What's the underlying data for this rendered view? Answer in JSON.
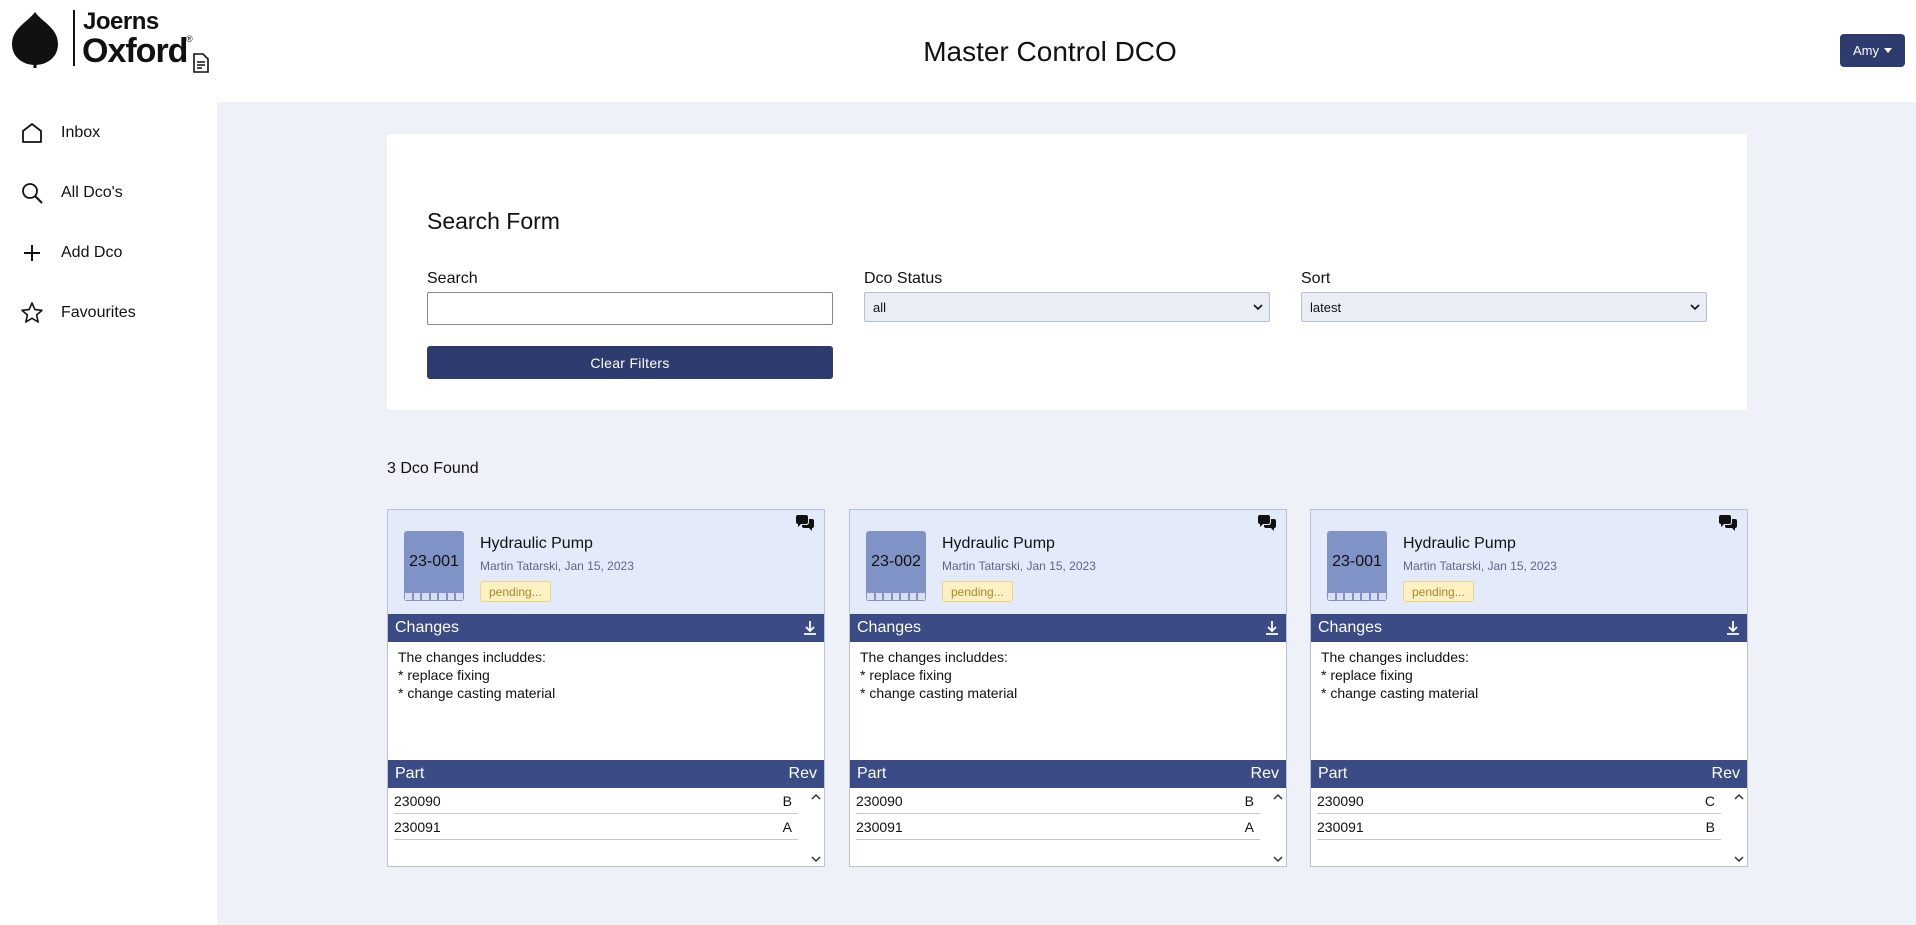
{
  "header": {
    "logo_top": "Joerns",
    "logo_bottom": "Oxford",
    "logo_reg": "®",
    "title": "Master Control DCO",
    "user_label": "Amy"
  },
  "sidebar": {
    "items": [
      {
        "label": "Inbox",
        "icon": "home-icon"
      },
      {
        "label": "All Dco's",
        "icon": "search-icon"
      },
      {
        "label": "Add Dco",
        "icon": "plus-icon"
      },
      {
        "label": "Favourites",
        "icon": "star-icon"
      }
    ]
  },
  "search_form": {
    "title": "Search Form",
    "search_label": "Search",
    "search_value": "",
    "status_label": "Dco Status",
    "status_value": "all",
    "sort_label": "Sort",
    "sort_value": "latest",
    "clear_label": "Clear Filters"
  },
  "results": {
    "found_text": "3 Dco Found",
    "cards": [
      {
        "number": "23-001",
        "title": "Hydraulic Pump",
        "author_date": "Martin Tatarski,  Jan 15, 2023",
        "status": "pending...",
        "changes_label": "Changes",
        "changes_lines": [
          "The changes includdes:",
          "* replace fixing",
          "* change casting material"
        ],
        "part_label": "Part",
        "rev_label": "Rev",
        "parts": [
          {
            "part": "230090",
            "rev": "B"
          },
          {
            "part": "230091",
            "rev": "A"
          }
        ]
      },
      {
        "number": "23-002",
        "title": "Hydraulic Pump",
        "author_date": "Martin Tatarski,  Jan 15, 2023",
        "status": "pending...",
        "changes_label": "Changes",
        "changes_lines": [
          "The changes includdes:",
          "* replace fixing",
          "* change casting material"
        ],
        "part_label": "Part",
        "rev_label": "Rev",
        "parts": [
          {
            "part": "230090",
            "rev": "B"
          },
          {
            "part": "230091",
            "rev": "A"
          }
        ]
      },
      {
        "number": "23-001",
        "title": "Hydraulic Pump",
        "author_date": "Martin Tatarski,  Jan 15, 2023",
        "status": "pending...",
        "changes_label": "Changes",
        "changes_lines": [
          "The changes includdes:",
          "* replace fixing",
          "* change casting material"
        ],
        "part_label": "Part",
        "rev_label": "Rev",
        "parts": [
          {
            "part": "230090",
            "rev": "C"
          },
          {
            "part": "230091",
            "rev": "B"
          }
        ]
      }
    ]
  },
  "colors": {
    "primary": "#2e3b6e",
    "section_bar": "#3a4b85",
    "card_header_bg": "#e3ebfb",
    "badge_bg": "#8093c6",
    "pending_bg": "#fdf0c2",
    "main_bg": "#eef1f7"
  }
}
